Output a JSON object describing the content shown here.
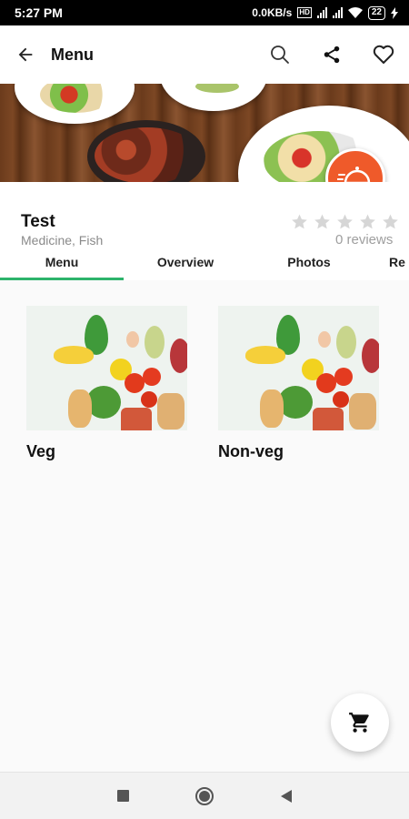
{
  "status_bar": {
    "time": "5:27 PM",
    "network_speed": "0.0KB/s",
    "battery": "22"
  },
  "app_bar": {
    "title": "Menu",
    "icons": [
      "back-arrow-icon",
      "search-icon",
      "share-icon",
      "heart-icon"
    ]
  },
  "restaurant": {
    "name": "Test",
    "tags": "Medicine,  Fish",
    "rating": 0,
    "rating_max": 5,
    "reviews_text": "0  reviews"
  },
  "tabs": [
    {
      "label": "Menu",
      "active": true
    },
    {
      "label": "Overview",
      "active": false
    },
    {
      "label": "Photos",
      "active": false
    },
    {
      "label": "Re",
      "active": false
    }
  ],
  "categories": [
    {
      "label": "Veg"
    },
    {
      "label": "Non-veg"
    }
  ],
  "colors": {
    "accent_green": "#2db36b",
    "delivery_orange": "#ef5a2a",
    "star_empty": "#d6d6d6"
  },
  "fabs": {
    "delivery_icon": "delivery-cloche-icon",
    "cart_icon": "cart-icon"
  },
  "nav": [
    "recents-square-icon",
    "home-circle-icon",
    "back-triangle-icon"
  ]
}
